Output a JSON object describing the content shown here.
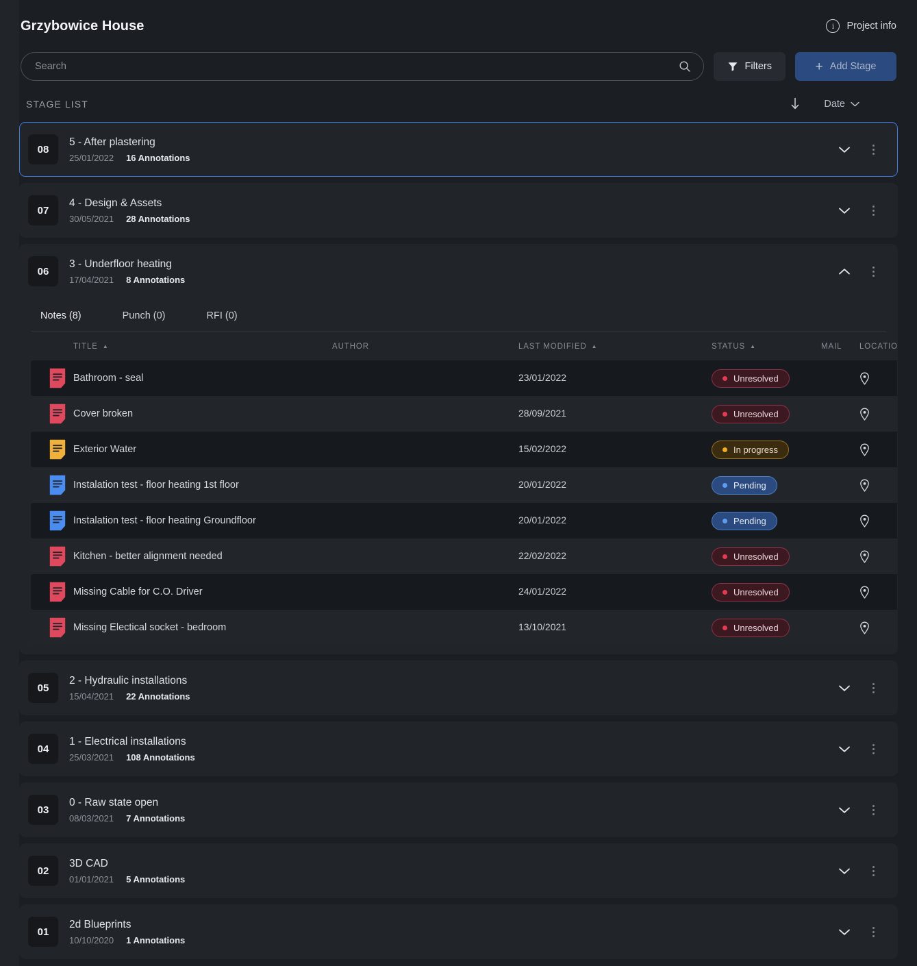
{
  "header": {
    "app_title": "Grzybowice House",
    "project_info_label": "Project info",
    "info_icon": "info-circle-icon"
  },
  "toolbar": {
    "search_placeholder": "Search",
    "search_value": "",
    "search_icon": "search-icon",
    "filters_label": "Filters",
    "filters_icon": "funnel-icon",
    "add_stage_label": "Add Stage",
    "add_stage_icon": "plus-icon",
    "accent_color": "#2b4b80"
  },
  "stage_list": {
    "title": "STAGE LIST",
    "sort_direction_icon": "arrow-down-icon",
    "sort_field_label": "Date",
    "sort_field_chevron": "chevron-down-icon",
    "stages": [
      {
        "number": "08",
        "name": "5 - After plastering",
        "date": "25/01/2022",
        "annotations": "16 Annotations",
        "expanded": false,
        "selected": true,
        "chevron": "chevron-down-icon"
      },
      {
        "number": "07",
        "name": "4 - Design & Assets",
        "date": "30/05/2021",
        "annotations": "28 Annotations",
        "expanded": false,
        "selected": false,
        "chevron": "chevron-down-icon"
      },
      {
        "number": "06",
        "name": "3 - Underfloor heating",
        "date": "17/04/2021",
        "annotations": "8 Annotations",
        "expanded": true,
        "selected": false,
        "chevron": "chevron-up-icon"
      },
      {
        "number": "05",
        "name": "2 - Hydraulic installations",
        "date": "15/04/2021",
        "annotations": "22 Annotations",
        "expanded": false,
        "selected": false,
        "chevron": "chevron-down-icon"
      },
      {
        "number": "04",
        "name": "1 - Electrical installations",
        "date": "25/03/2021",
        "annotations": "108 Annotations",
        "expanded": false,
        "selected": false,
        "chevron": "chevron-down-icon"
      },
      {
        "number": "03",
        "name": "0 - Raw state open",
        "date": "08/03/2021",
        "annotations": "7 Annotations",
        "expanded": false,
        "selected": false,
        "chevron": "chevron-down-icon"
      },
      {
        "number": "02",
        "name": "3D CAD",
        "date": "01/01/2021",
        "annotations": "5 Annotations",
        "expanded": false,
        "selected": false,
        "chevron": "chevron-down-icon"
      },
      {
        "number": "01",
        "name": "2d Blueprints",
        "date": "10/10/2020",
        "annotations": "1 Annotations",
        "expanded": false,
        "selected": false,
        "chevron": "chevron-down-icon"
      }
    ]
  },
  "expanded_panel": {
    "tabs": [
      {
        "label": "Notes (8)",
        "active": true
      },
      {
        "label": "Punch (0)",
        "active": false
      },
      {
        "label": "RFI (0)",
        "active": false
      }
    ],
    "columns": [
      {
        "label": "",
        "sort": ""
      },
      {
        "label": "TITLE",
        "sort": "asc"
      },
      {
        "label": "AUTHOR",
        "sort": ""
      },
      {
        "label": "LAST MODIFIED",
        "sort": "asc"
      },
      {
        "label": "STATUS",
        "sort": "asc"
      },
      {
        "label": "MAIL",
        "sort": ""
      },
      {
        "label": "LOCATION",
        "sort": ""
      }
    ],
    "rows": [
      {
        "icon": "note-icon",
        "icon_color": "#e0485e",
        "title": "Bathroom - seal",
        "author": "",
        "author_redacted": true,
        "last_modified": "23/01/2022",
        "status": "Unresolved",
        "status_kind": "unresolved",
        "mail": "",
        "location_icon": "map-pin-icon"
      },
      {
        "icon": "note-icon",
        "icon_color": "#e0485e",
        "title": "Cover broken",
        "author": "",
        "author_redacted": true,
        "last_modified": "28/09/2021",
        "status": "Unresolved",
        "status_kind": "unresolved",
        "mail": "",
        "location_icon": "map-pin-icon"
      },
      {
        "icon": "note-icon",
        "icon_color": "#f0b03c",
        "title": "Exterior Water",
        "author": "",
        "author_redacted": true,
        "last_modified": "15/02/2022",
        "status": "In progress",
        "status_kind": "inprogress",
        "mail": "",
        "location_icon": "map-pin-icon"
      },
      {
        "icon": "note-icon",
        "icon_color": "#4a8cf0",
        "title": "Instalation test - floor heating 1st floor",
        "author": "",
        "author_redacted": true,
        "last_modified": "20/01/2022",
        "status": "Pending",
        "status_kind": "pending",
        "mail": "",
        "location_icon": "map-pin-icon"
      },
      {
        "icon": "note-icon",
        "icon_color": "#4a8cf0",
        "title": "Instalation test - floor heating Groundfloor",
        "author": "",
        "author_redacted": true,
        "last_modified": "20/01/2022",
        "status": "Pending",
        "status_kind": "pending",
        "mail": "",
        "location_icon": "map-pin-icon"
      },
      {
        "icon": "note-icon",
        "icon_color": "#e0485e",
        "title": "Kitchen - better alignment needed",
        "author": "",
        "author_redacted": true,
        "last_modified": "22/02/2022",
        "status": "Unresolved",
        "status_kind": "unresolved",
        "mail": "",
        "location_icon": "map-pin-icon"
      },
      {
        "icon": "note-icon",
        "icon_color": "#e0485e",
        "title": "Missing Cable for C.O. Driver",
        "author": "",
        "author_redacted": true,
        "last_modified": "24/01/2022",
        "status": "Unresolved",
        "status_kind": "unresolved",
        "mail": "",
        "location_icon": "map-pin-icon"
      },
      {
        "icon": "note-icon",
        "icon_color": "#e0485e",
        "title": "Missing Electical socket - bedroom",
        "author": "",
        "author_redacted": true,
        "last_modified": "13/10/2021",
        "status": "Unresolved",
        "status_kind": "unresolved",
        "mail": "",
        "location_icon": "map-pin-icon"
      }
    ]
  },
  "colors": {
    "page_bg": "#1b1e23",
    "card_bg": "#212429",
    "selected_border": "#3d7ae4",
    "row_odd": "#16191d",
    "row_even": "#22252a",
    "unresolved": "#e23b54",
    "in_progress": "#f0ad22",
    "pending": "#5d9cf0"
  }
}
